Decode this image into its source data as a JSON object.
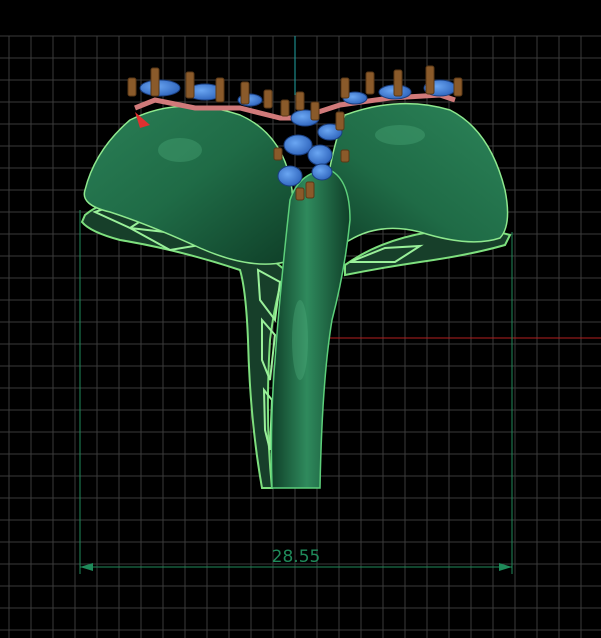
{
  "viewport": {
    "background": "#000000",
    "grid_color": "#3a3a3a",
    "grid_visible": true
  },
  "axes": {
    "vertical_axis_color": "#1fa3a3",
    "horizontal_axis_color": "#b32020"
  },
  "model": {
    "object": "ring",
    "ring_body_color": "#1f6b46",
    "ring_highlight_color": "#4fae7e",
    "wire_outline_color": "#7ee07e",
    "gem_color": "#3b7fe0",
    "prong_color": "#8a5a2a",
    "seat_color": "#d07a7a"
  },
  "dimension": {
    "value": "28.55",
    "color": "#1f8a5a"
  }
}
